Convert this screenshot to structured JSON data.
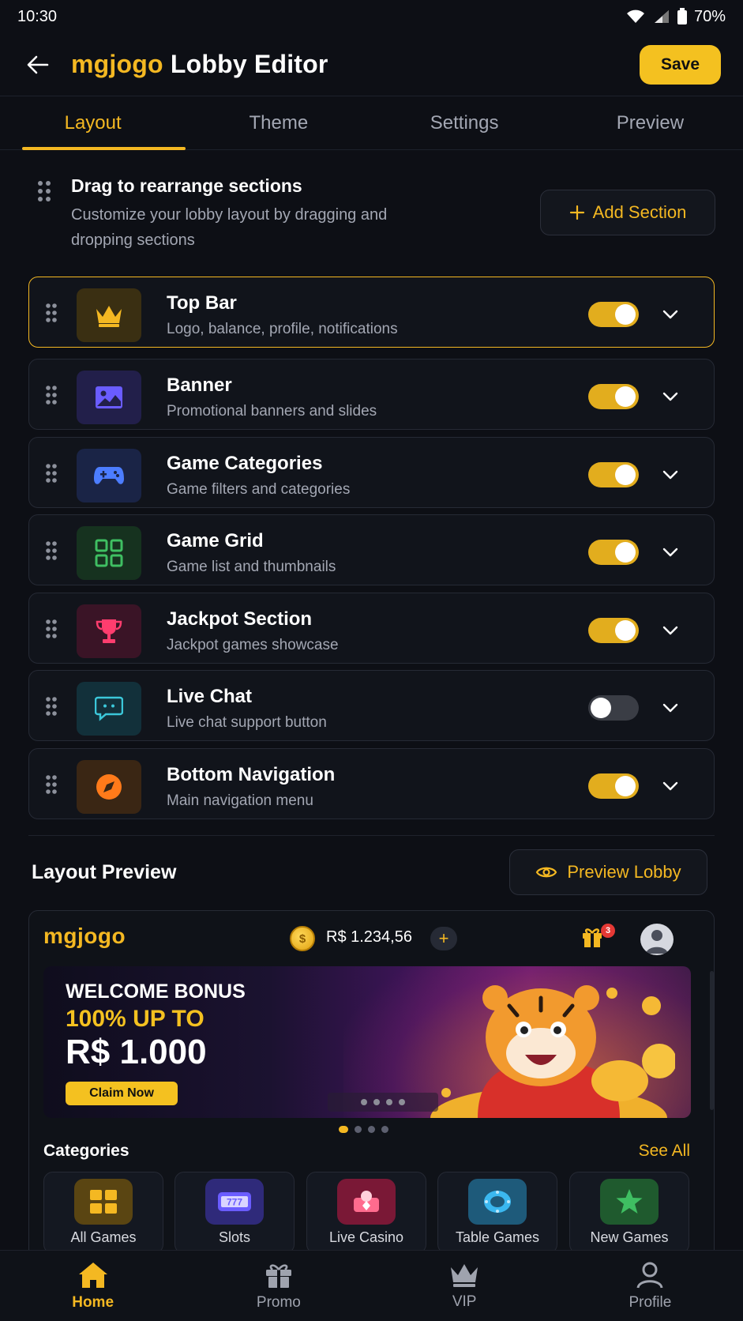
{
  "status_bar": {
    "time": "10:30",
    "battery": "70%"
  },
  "header": {
    "brand": "mgjogo",
    "title": "Lobby Editor",
    "save_label": "Save"
  },
  "tabs": [
    {
      "label": "Layout",
      "active": true
    },
    {
      "label": "Theme",
      "active": false
    },
    {
      "label": "Settings",
      "active": false
    },
    {
      "label": "Preview",
      "active": false
    }
  ],
  "intro": {
    "title": "Drag to rearrange sections",
    "description": "Customize your lobby layout by dragging and dropping sections",
    "add_section_label": "Add Section"
  },
  "sections": [
    {
      "title": "Top Bar",
      "subtitle": "Logo, balance, profile, notifications",
      "enabled": true,
      "selected": true,
      "icon": "crown-icon",
      "color": "#f4b822"
    },
    {
      "title": "Banner",
      "subtitle": "Promotional banners and slides",
      "enabled": true,
      "icon": "image-icon",
      "color": "#6a5cff"
    },
    {
      "title": "Game Categories",
      "subtitle": "Game filters and categories",
      "enabled": true,
      "icon": "gamepad-icon",
      "color": "#4c7dff"
    },
    {
      "title": "Game Grid",
      "subtitle": "Game list and thumbnails",
      "enabled": true,
      "icon": "grid-icon",
      "color": "#3fbf62"
    },
    {
      "title": "Jackpot Section",
      "subtitle": "Jackpot games showcase",
      "enabled": true,
      "icon": "trophy-icon",
      "color": "#ff3d6e"
    },
    {
      "title": "Live Chat",
      "subtitle": "Live chat support button",
      "enabled": false,
      "icon": "chat-icon",
      "color": "#3bc7d9"
    },
    {
      "title": "Bottom Navigation",
      "subtitle": "Main navigation menu",
      "enabled": true,
      "icon": "compass-icon",
      "color": "#ff7a1a"
    }
  ],
  "layout_preview": {
    "title": "Layout Preview",
    "preview_button_label": "Preview Lobby",
    "logo": "mgjogo",
    "balance": "R$ 1.234,56",
    "notification_count": "3",
    "banner": {
      "line1": "WELCOME BONUS",
      "line2": "100% UP TO",
      "line3": "R$ 1.000",
      "cta": "Claim Now"
    },
    "categories_title": "Categories",
    "see_all_label": "See All",
    "categories": [
      {
        "label": "All Games",
        "icon": "grid-icon",
        "color": "#f4b822"
      },
      {
        "label": "Slots",
        "icon": "slot-machine-icon",
        "color": "#6a5cff"
      },
      {
        "label": "Live Casino",
        "icon": "live-dealer-icon",
        "color": "#ff3d6e"
      },
      {
        "label": "Table Games",
        "icon": "poker-chip-icon",
        "color": "#3bb8f0"
      },
      {
        "label": "New Games",
        "icon": "star-icon",
        "color": "#3fbf62"
      }
    ]
  },
  "bottom_nav": [
    {
      "label": "Home",
      "icon": "home-icon",
      "active": true
    },
    {
      "label": "Promo",
      "icon": "gift-icon",
      "active": false
    },
    {
      "label": "VIP",
      "icon": "crown-icon",
      "active": false
    },
    {
      "label": "Profile",
      "icon": "user-icon",
      "active": false
    }
  ]
}
